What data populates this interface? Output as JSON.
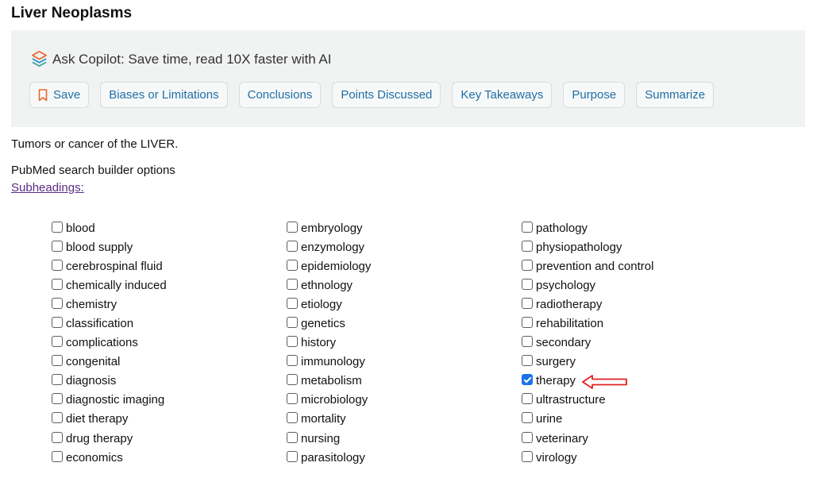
{
  "page": {
    "title": "Liver Neoplasms"
  },
  "copilot": {
    "icon": "copilot-stack-icon",
    "title": "Ask Copilot: Save time, read 10X faster with AI",
    "buttons": [
      {
        "label": "Save",
        "icon": "bookmark-icon"
      },
      {
        "label": "Biases or Limitations"
      },
      {
        "label": "Conclusions"
      },
      {
        "label": "Points Discussed"
      },
      {
        "label": "Key Takeaways"
      },
      {
        "label": "Purpose"
      },
      {
        "label": "Summarize"
      }
    ]
  },
  "description": "Tumors or cancer of the LIVER.",
  "search_builder": {
    "label": "PubMed search builder options",
    "subheadings_link": "Subheadings:"
  },
  "subheadings": {
    "columns": [
      [
        {
          "label": "blood",
          "checked": false
        },
        {
          "label": "blood supply",
          "checked": false
        },
        {
          "label": "cerebrospinal fluid",
          "checked": false
        },
        {
          "label": "chemically induced",
          "checked": false
        },
        {
          "label": "chemistry",
          "checked": false
        },
        {
          "label": "classification",
          "checked": false
        },
        {
          "label": "complications",
          "checked": false
        },
        {
          "label": "congenital",
          "checked": false
        },
        {
          "label": "diagnosis",
          "checked": false
        },
        {
          "label": "diagnostic imaging",
          "checked": false
        },
        {
          "label": "diet therapy",
          "checked": false
        },
        {
          "label": "drug therapy",
          "checked": false
        },
        {
          "label": "economics",
          "checked": false
        }
      ],
      [
        {
          "label": "embryology",
          "checked": false
        },
        {
          "label": "enzymology",
          "checked": false
        },
        {
          "label": "epidemiology",
          "checked": false
        },
        {
          "label": "ethnology",
          "checked": false
        },
        {
          "label": "etiology",
          "checked": false
        },
        {
          "label": "genetics",
          "checked": false
        },
        {
          "label": "history",
          "checked": false
        },
        {
          "label": "immunology",
          "checked": false
        },
        {
          "label": "metabolism",
          "checked": false
        },
        {
          "label": "microbiology",
          "checked": false
        },
        {
          "label": "mortality",
          "checked": false
        },
        {
          "label": "nursing",
          "checked": false
        },
        {
          "label": "parasitology",
          "checked": false
        }
      ],
      [
        {
          "label": "pathology",
          "checked": false
        },
        {
          "label": "physiopathology",
          "checked": false
        },
        {
          "label": "prevention and control",
          "checked": false
        },
        {
          "label": "psychology",
          "checked": false
        },
        {
          "label": "radiotherapy",
          "checked": false
        },
        {
          "label": "rehabilitation",
          "checked": false
        },
        {
          "label": "secondary",
          "checked": false
        },
        {
          "label": "surgery",
          "checked": false
        },
        {
          "label": "therapy",
          "checked": true
        },
        {
          "label": "ultrastructure",
          "checked": false
        },
        {
          "label": "urine",
          "checked": false
        },
        {
          "label": "veterinary",
          "checked": false
        },
        {
          "label": "virology",
          "checked": false
        }
      ]
    ]
  },
  "annotation": {
    "icon": "red-arrow-icon",
    "color": "#e02020"
  },
  "colors": {
    "copilot_bg": "#f1f3f2",
    "button_text": "#1f6ea5",
    "save_icon": "#e8662e",
    "link": "#5b2a87",
    "checkbox_checked": "#1a73e8"
  }
}
